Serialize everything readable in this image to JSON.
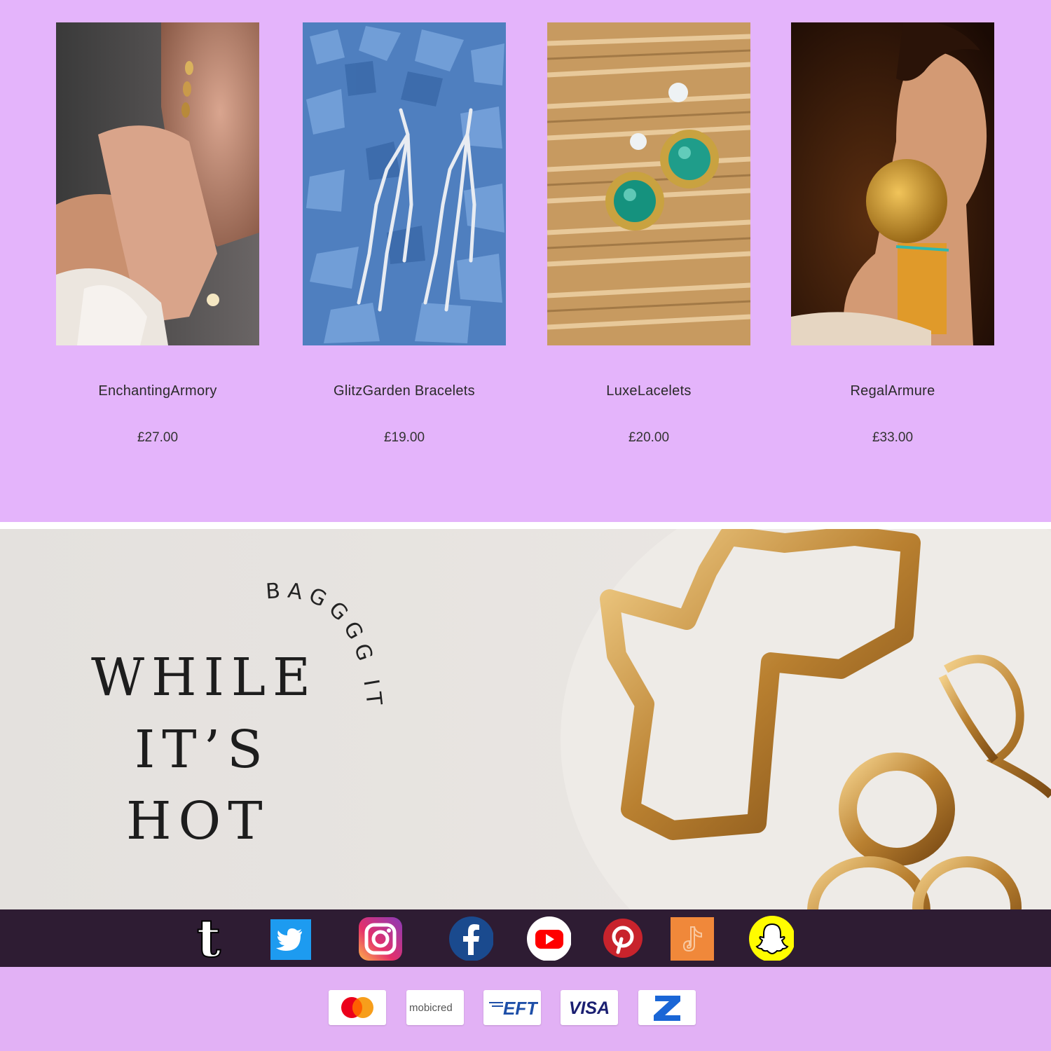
{
  "products": [
    {
      "name": "EnchantingArmory",
      "price": "£27.00",
      "image": "woman-hand-jewelry-photo"
    },
    {
      "name": "GlitzGarden Bracelets",
      "price": "£19.00",
      "image": "crystal-earrings-blue-stones-photo"
    },
    {
      "name": "LuxeLacelets",
      "price": "£20.00",
      "image": "green-gem-earrings-bamboo-photo"
    },
    {
      "name": "RegalArmure",
      "price": "£33.00",
      "image": "woman-gold-earring-photo"
    }
  ],
  "banner": {
    "headline": [
      "WHILE",
      "IT’S",
      "HOT"
    ],
    "curved_text": "BAGGGG IT",
    "image": "gold-jewelry-plate-photo"
  },
  "social": [
    {
      "name": "tumblr",
      "icon": "tumblr-icon"
    },
    {
      "name": "twitter",
      "icon": "twitter-icon"
    },
    {
      "name": "instagram",
      "icon": "instagram-icon"
    },
    {
      "name": "facebook",
      "icon": "facebook-icon"
    },
    {
      "name": "youtube",
      "icon": "youtube-icon"
    },
    {
      "name": "pinterest",
      "icon": "pinterest-icon"
    },
    {
      "name": "tiktok",
      "icon": "tiktok-icon"
    },
    {
      "name": "snapchat",
      "icon": "snapchat-icon"
    }
  ],
  "payments": {
    "mastercard": "mastercard-logo",
    "mobicred": "mobicred",
    "eft": "EFT",
    "visa": "VISA",
    "zapper": "zapper-logo"
  },
  "colors": {
    "page_bg": "#e4b4fb",
    "social_bar": "#2e1c33",
    "banner_bg": "#e6e3e0",
    "twitter": "#1d9bf0",
    "facebook": "#1a4a8e",
    "youtube": "#ff0000",
    "pinterest": "#c8232c",
    "tiktok": "#f0883a",
    "snapchat": "#fffc00"
  }
}
